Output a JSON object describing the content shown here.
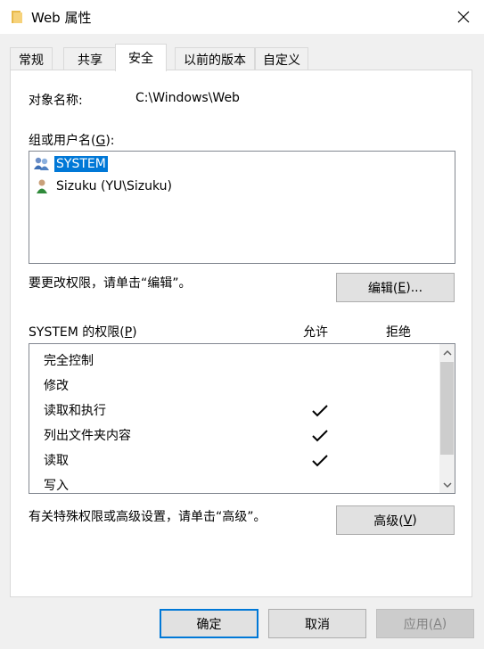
{
  "window": {
    "title": "Web 属性",
    "close_icon": "close-icon",
    "folder_icon": "folder-icon"
  },
  "tabs": [
    {
      "label": "常规",
      "active": false
    },
    {
      "label": "共享",
      "active": false
    },
    {
      "label": "安全",
      "active": true
    },
    {
      "label": "以前的版本",
      "active": false
    },
    {
      "label": "自定义",
      "active": false
    }
  ],
  "object": {
    "label": "对象名称:",
    "value": "C:\\Windows\\Web"
  },
  "groups": {
    "label_prefix": "组或用户名(",
    "label_key": "G",
    "label_suffix": "):",
    "items": [
      {
        "name": "SYSTEM",
        "icon": "users-group-icon",
        "selected": true
      },
      {
        "name": "Sizuku (YU\\Sizuku)",
        "icon": "user-icon",
        "selected": false
      }
    ]
  },
  "edit": {
    "hint": "要更改权限，请单击“编辑”。",
    "button_prefix": "编辑(",
    "button_key": "E",
    "button_suffix": ")..."
  },
  "permissions": {
    "title_prefix": "SYSTEM 的权限(",
    "title_key": "P",
    "title_suffix": ")",
    "allow_header": "允许",
    "deny_header": "拒绝",
    "rows": [
      {
        "name": "完全控制",
        "allow": false,
        "deny": false
      },
      {
        "name": "修改",
        "allow": false,
        "deny": false
      },
      {
        "name": "读取和执行",
        "allow": true,
        "deny": false
      },
      {
        "name": "列出文件夹内容",
        "allow": true,
        "deny": false
      },
      {
        "name": "读取",
        "allow": true,
        "deny": false
      },
      {
        "name": "写入",
        "allow": false,
        "deny": false
      }
    ]
  },
  "advanced": {
    "hint": "有关特殊权限或高级设置，请单击“高级”。",
    "button_prefix": "高级(",
    "button_key": "V",
    "button_suffix": ")"
  },
  "footer": {
    "ok": "确定",
    "cancel": "取消",
    "apply_prefix": "应用(",
    "apply_key": "A",
    "apply_suffix": ")"
  },
  "colors": {
    "selection": "#0078d7",
    "default_button_border": "#0078d7",
    "disabled_text": "#838383"
  }
}
